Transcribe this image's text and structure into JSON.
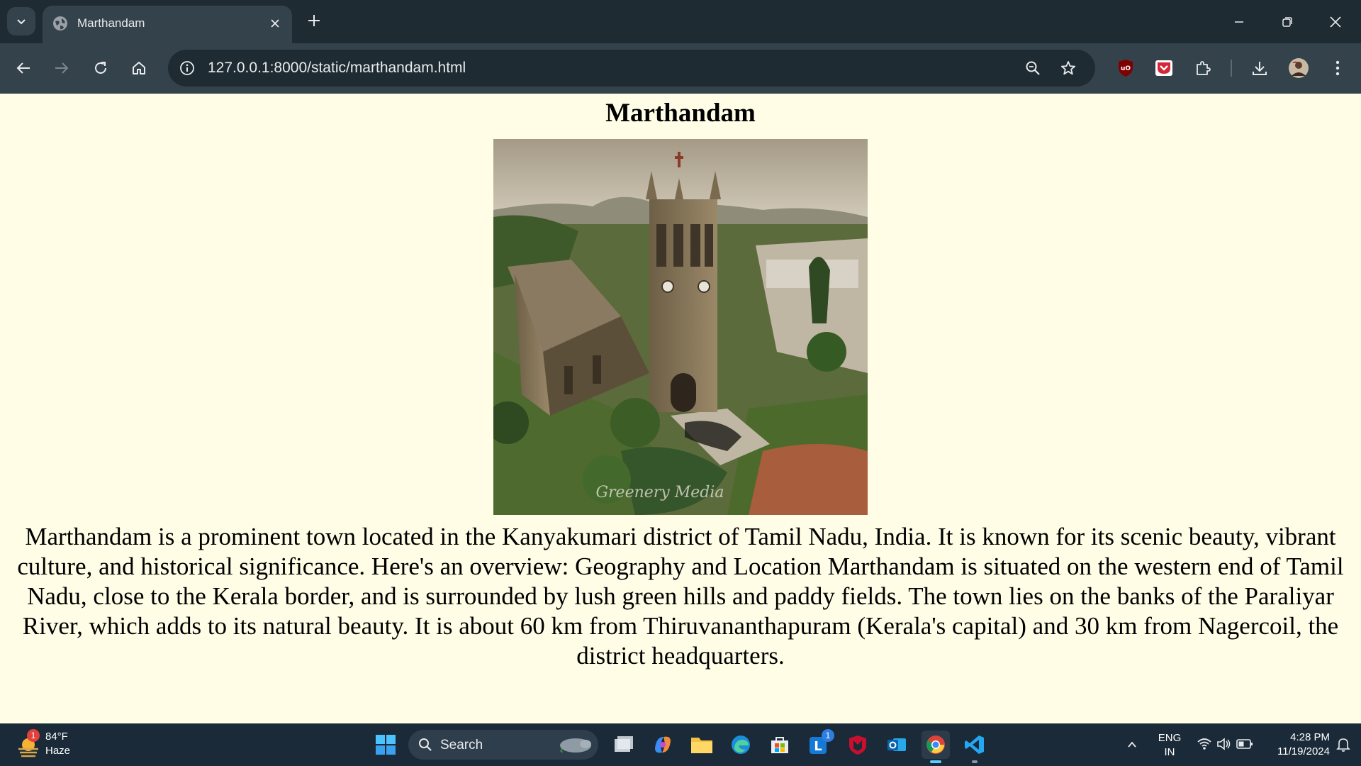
{
  "browser": {
    "tab": {
      "title": "Marthandam"
    },
    "address_bar": {
      "url": "127.0.0.1:8000/static/marthandam.html"
    },
    "colors": {
      "frame": "#1f2b33",
      "toolbar": "#33424b",
      "page_bg": "#fffde6"
    }
  },
  "page": {
    "heading": "Marthandam",
    "image": {
      "alt": "Aerial view of a stone church with clock tower surrounded by gardens",
      "watermark": "Greenery Media"
    },
    "paragraph": "Marthandam is a prominent town located in the Kanyakumari district of Tamil Nadu, India. It is known for its scenic beauty, vibrant culture, and historical significance. Here's an overview: Geography and Location Marthandam is situated on the western end of Tamil Nadu, close to the Kerala border, and is surrounded by lush green hills and paddy fields. The town lies on the banks of the Paraliyar River, which adds to its natural beauty. It is about 60 km from Thiruvananthapuram (Kerala's capital) and 30 km from Nagercoil, the district headquarters."
  },
  "taskbar": {
    "weather": {
      "temp": "84°F",
      "condition": "Haze",
      "badge": "1"
    },
    "search_label": "Search",
    "apps": [
      "windows-start",
      "search",
      "task-view",
      "copilot",
      "file-explorer",
      "edge",
      "microsoft-store",
      "linkedin",
      "mcafee",
      "outlook",
      "chrome",
      "vscode"
    ],
    "linkedin_badge": "1",
    "language": {
      "line1": "ENG",
      "line2": "IN"
    },
    "clock": {
      "time": "4:28 PM",
      "date": "11/19/2024"
    }
  }
}
